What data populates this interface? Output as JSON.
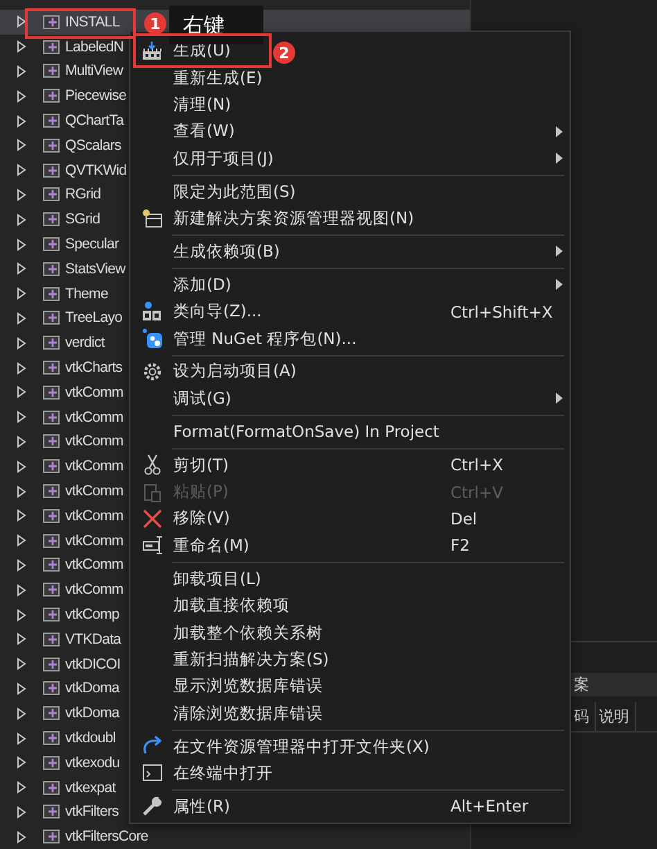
{
  "tree": {
    "items": [
      {
        "label": "INSTALL",
        "selected": true
      },
      {
        "label": "LabeledN",
        "selected": false
      },
      {
        "label": "MultiView",
        "selected": false
      },
      {
        "label": "Piecewise",
        "selected": false
      },
      {
        "label": "QChartTa",
        "selected": false
      },
      {
        "label": "QScalars",
        "selected": false
      },
      {
        "label": "QVTKWid",
        "selected": false
      },
      {
        "label": "RGrid",
        "selected": false
      },
      {
        "label": "SGrid",
        "selected": false
      },
      {
        "label": "Specular",
        "selected": false
      },
      {
        "label": "StatsView",
        "selected": false
      },
      {
        "label": "Theme",
        "selected": false
      },
      {
        "label": "TreeLayo",
        "selected": false
      },
      {
        "label": "verdict",
        "selected": false
      },
      {
        "label": "vtkCharts",
        "selected": false
      },
      {
        "label": "vtkComm",
        "selected": false
      },
      {
        "label": "vtkComm",
        "selected": false
      },
      {
        "label": "vtkComm",
        "selected": false
      },
      {
        "label": "vtkComm",
        "selected": false
      },
      {
        "label": "vtkComm",
        "selected": false
      },
      {
        "label": "vtkComm",
        "selected": false
      },
      {
        "label": "vtkComm",
        "selected": false
      },
      {
        "label": "vtkComm",
        "selected": false
      },
      {
        "label": "vtkComm",
        "selected": false
      },
      {
        "label": "vtkComp",
        "selected": false
      },
      {
        "label": "VTKData",
        "selected": false
      },
      {
        "label": "vtkDICOI",
        "selected": false
      },
      {
        "label": "vtkDoma",
        "selected": false
      },
      {
        "label": "vtkDoma",
        "selected": false
      },
      {
        "label": "vtkdoubl",
        "selected": false
      },
      {
        "label": "vtkexodu",
        "selected": false
      },
      {
        "label": "vtkexpat",
        "selected": false
      },
      {
        "label": "vtkFilters",
        "selected": false
      },
      {
        "label": "vtkFiltersCore",
        "selected": false
      }
    ]
  },
  "context_menu": {
    "items": [
      {
        "kind": "item",
        "label": "生成(U)"
      },
      {
        "kind": "item",
        "label": "重新生成(E)"
      },
      {
        "kind": "item",
        "label": "清理(N)"
      },
      {
        "kind": "item",
        "label": "查看(W)",
        "submenu": true
      },
      {
        "kind": "item",
        "label": "仅用于项目(J)",
        "submenu": true
      },
      {
        "kind": "separator"
      },
      {
        "kind": "item",
        "label": "限定为此范围(S)"
      },
      {
        "kind": "item",
        "label": "新建解决方案资源管理器视图(N)"
      },
      {
        "kind": "separator"
      },
      {
        "kind": "item",
        "label": "生成依赖项(B)",
        "submenu": true
      },
      {
        "kind": "separator"
      },
      {
        "kind": "item",
        "label": "添加(D)",
        "submenu": true
      },
      {
        "kind": "item",
        "label": "类向导(Z)...",
        "shortcut": "Ctrl+Shift+X"
      },
      {
        "kind": "item",
        "label": "管理 NuGet 程序包(N)..."
      },
      {
        "kind": "separator"
      },
      {
        "kind": "item",
        "label": "设为启动项目(A)"
      },
      {
        "kind": "item",
        "label": "调试(G)",
        "submenu": true
      },
      {
        "kind": "separator"
      },
      {
        "kind": "item",
        "label": "Format(FormatOnSave) In Project"
      },
      {
        "kind": "separator"
      },
      {
        "kind": "item",
        "label": "剪切(T)",
        "shortcut": "Ctrl+X"
      },
      {
        "kind": "item",
        "label": "粘贴(P)",
        "shortcut": "Ctrl+V",
        "disabled": true
      },
      {
        "kind": "item",
        "label": "移除(V)",
        "shortcut": "Del"
      },
      {
        "kind": "item",
        "label": "重命名(M)",
        "shortcut": "F2"
      },
      {
        "kind": "separator"
      },
      {
        "kind": "item",
        "label": "卸载项目(L)"
      },
      {
        "kind": "item",
        "label": "加载直接依赖项"
      },
      {
        "kind": "item",
        "label": "加载整个依赖关系树"
      },
      {
        "kind": "item",
        "label": "重新扫描解决方案(S)"
      },
      {
        "kind": "item",
        "label": "显示浏览数据库错误"
      },
      {
        "kind": "item",
        "label": "清除浏览数据库错误"
      },
      {
        "kind": "separator"
      },
      {
        "kind": "item",
        "label": "在文件资源管理器中打开文件夹(X)"
      },
      {
        "kind": "item",
        "label": "在终端中打开"
      },
      {
        "kind": "separator"
      },
      {
        "kind": "item",
        "label": "属性(R)",
        "shortcut": "Alt+Enter"
      }
    ]
  },
  "side_panel": {
    "header": "案",
    "columns": [
      "码",
      "说明"
    ]
  },
  "callouts": [
    {
      "number": "1",
      "note": "右键"
    },
    {
      "number": "2"
    }
  ]
}
